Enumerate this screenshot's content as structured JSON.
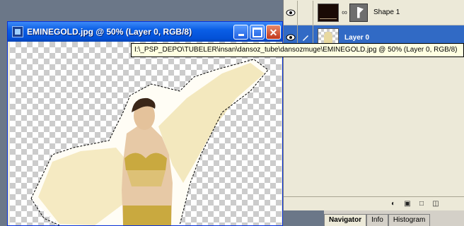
{
  "document_window": {
    "title": "EMINEGOLD.jpg @ 50% (Layer 0, RGB/8)",
    "icon": "photoshop-doc-icon"
  },
  "tooltip": {
    "text": "I:\\_PSP_DEPO\\TUBELER\\insan\\dansoz_tube\\dansozmuge\\EMINEGOLD.jpg @ 50% (Layer 0, RGB/8)"
  },
  "layers": [
    {
      "name": "Shape 1",
      "visible": true,
      "selected": false
    },
    {
      "name": "Layer 0",
      "visible": true,
      "selected": true
    }
  ],
  "navigator": {
    "tabs": [
      "Navigator",
      "Info",
      "Histogram"
    ],
    "active_tab": "Navigator"
  },
  "colors": {
    "titlebar": "#0a5ee6",
    "selected_layer": "#316ac5",
    "tooltip_bg": "#ffffe1"
  }
}
